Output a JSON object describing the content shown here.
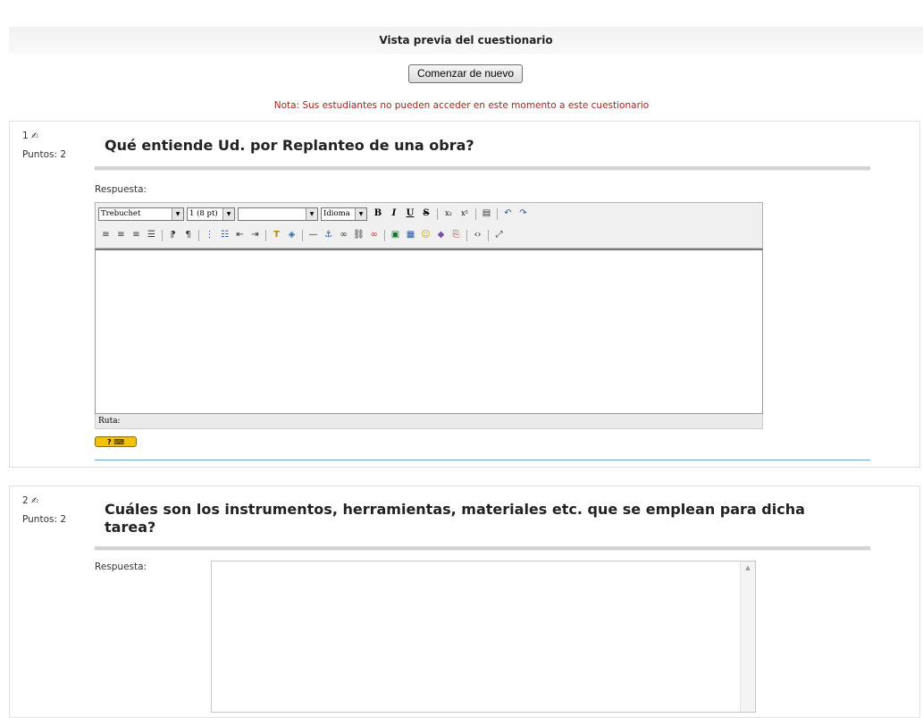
{
  "header": {
    "title": "Vista previa del cuestionario",
    "restart_label": "Comenzar de nuevo",
    "note": "Nota: Sus estudiantes no pueden acceder en este momento a este cuestionario"
  },
  "questions": [
    {
      "number": "1",
      "points": "Puntos: 2",
      "text": "Qué entiende Ud. por Replanteo de una obra?",
      "answer_label": "Respuesta:"
    },
    {
      "number": "2",
      "points": "Puntos: 2",
      "text": "Cuáles son los instrumentos, herramientas, materiales etc. que se emplean para dicha tarea?",
      "answer_label": "Respuesta:"
    }
  ],
  "editor": {
    "font_select": "Trebuchet",
    "size_select": "1 (8 pt)",
    "style_select": "",
    "lang_select": "Idioma",
    "bold": "B",
    "italic": "I",
    "underline": "U",
    "strike": "S",
    "path_label": "Ruta:",
    "help_label": "?"
  },
  "icons": [
    "edit-pencil-icon",
    "bold-icon",
    "italic-icon",
    "underline-icon",
    "strikethrough-icon",
    "subscript-icon",
    "superscript-icon",
    "clean-word-icon",
    "undo-icon",
    "redo-icon",
    "align-left-icon",
    "align-center-icon",
    "align-right-icon",
    "justify-icon",
    "ltr-icon",
    "rtl-icon",
    "ordered-list-icon",
    "unordered-list-icon",
    "outdent-icon",
    "indent-icon",
    "text-color-icon",
    "bg-color-icon",
    "horizontal-rule-icon",
    "anchor-icon",
    "link-icon",
    "unlink-icon",
    "nolink-icon",
    "image-icon",
    "table-icon",
    "smiley-icon",
    "special-char-icon",
    "search-replace-icon",
    "html-source-icon",
    "fullscreen-icon"
  ],
  "colors": {
    "note": "#a0281e",
    "help_button": "#f2c10a",
    "separator_line": "#6aa8dc"
  }
}
